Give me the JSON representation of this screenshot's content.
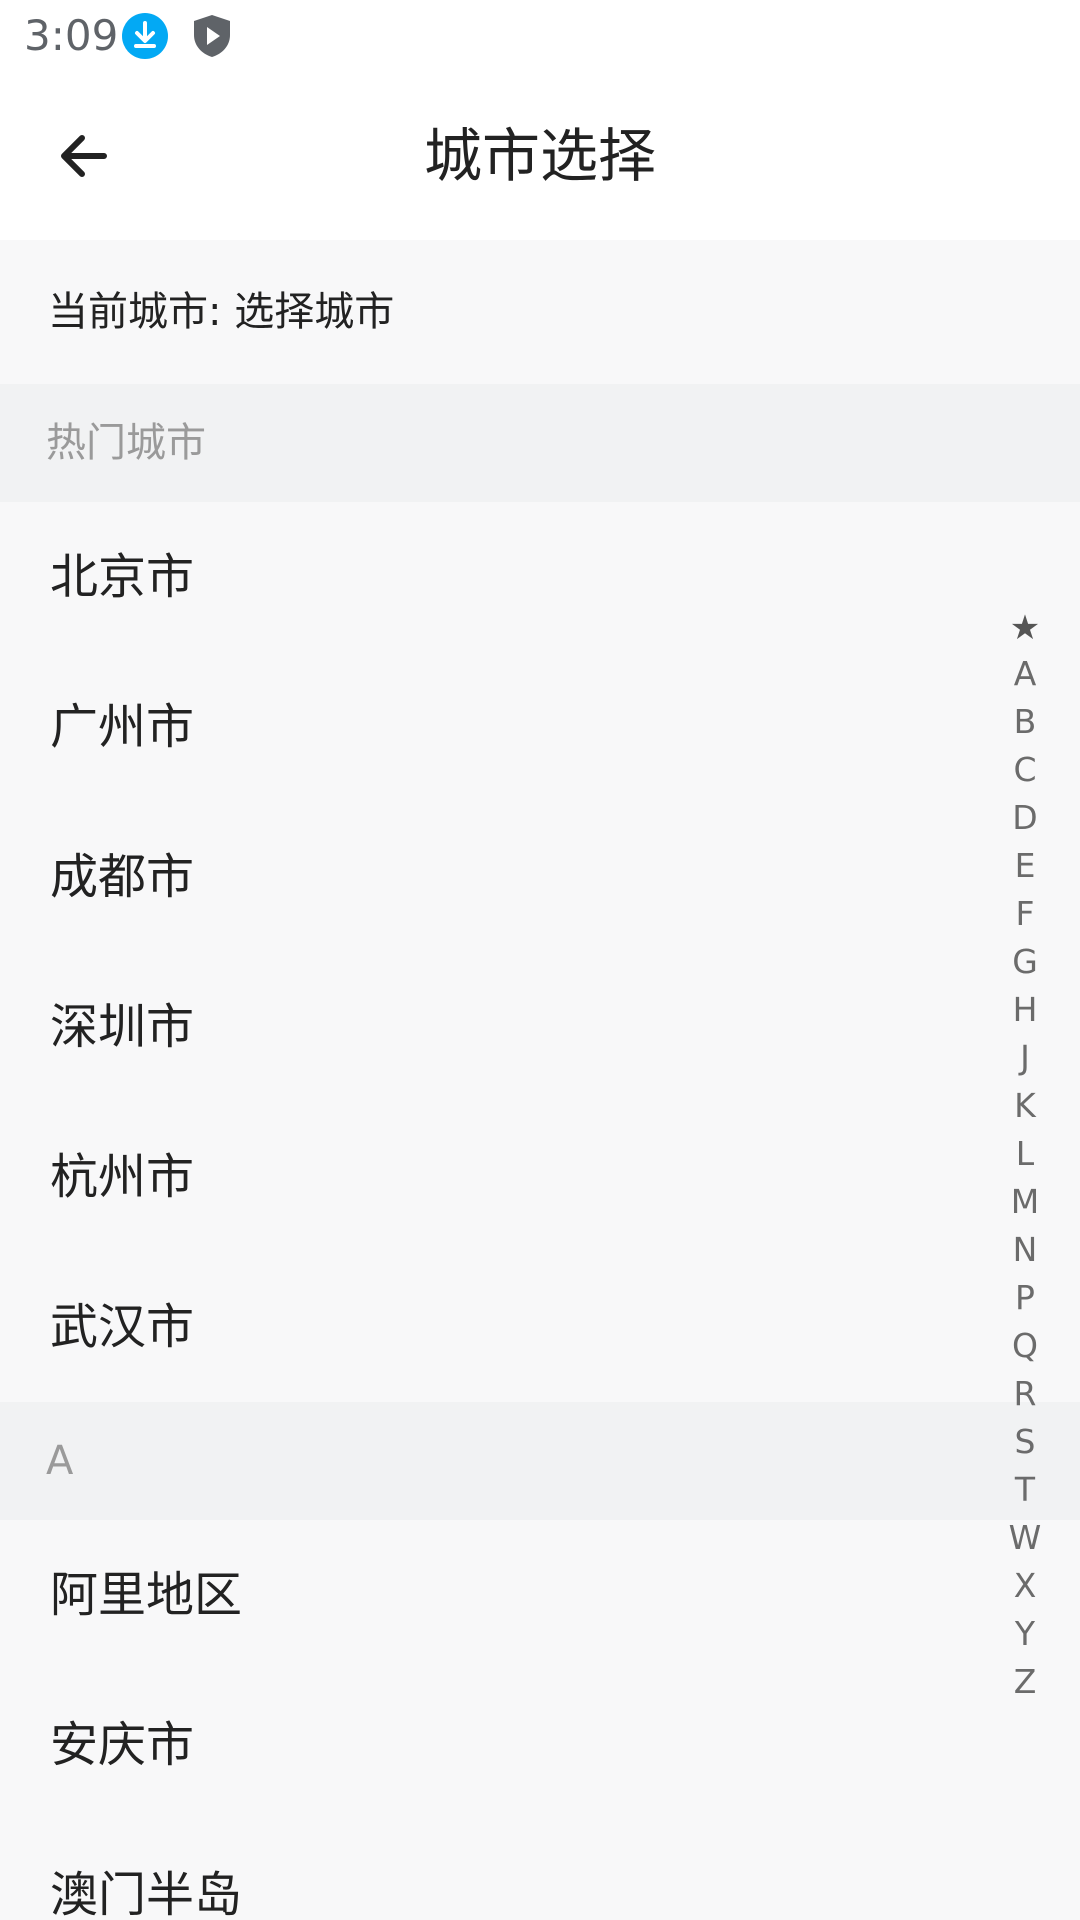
{
  "status_bar": {
    "time": "3:09",
    "icons": [
      "download-icon",
      "shield-play-icon"
    ],
    "download_color": "#03a9f4"
  },
  "app_bar": {
    "title": "城市选择",
    "back_icon": "arrow-left-icon"
  },
  "current_city": {
    "text": "当前城市: 选择城市"
  },
  "sections": [
    {
      "header": "热门城市",
      "cities": [
        "北京市",
        "广州市",
        "成都市",
        "深圳市",
        "杭州市",
        "武汉市"
      ]
    },
    {
      "header": "A",
      "cities": [
        "阿里地区",
        "安庆市",
        "澳门半岛"
      ]
    }
  ],
  "index": [
    "★",
    "A",
    "B",
    "C",
    "D",
    "E",
    "F",
    "G",
    "H",
    "J",
    "K",
    "L",
    "M",
    "N",
    "P",
    "Q",
    "R",
    "S",
    "T",
    "W",
    "X",
    "Y",
    "Z"
  ]
}
